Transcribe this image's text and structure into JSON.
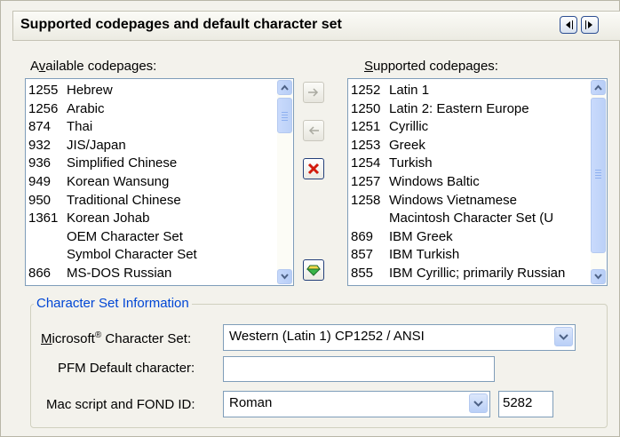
{
  "header": {
    "title": "Supported codepages and  default character set"
  },
  "available": {
    "label_prefix": "A",
    "label_mnemonic": "v",
    "label_suffix": "ailable codepages:",
    "items": [
      {
        "code": "1255",
        "name": "Hebrew"
      },
      {
        "code": "1256",
        "name": "Arabic"
      },
      {
        "code": "874",
        "name": "Thai"
      },
      {
        "code": "932",
        "name": "JIS/Japan"
      },
      {
        "code": "936",
        "name": "Simplified Chinese"
      },
      {
        "code": "949",
        "name": "Korean Wansung"
      },
      {
        "code": "950",
        "name": "Traditional Chinese"
      },
      {
        "code": "1361",
        "name": "Korean Johab"
      },
      {
        "code": "",
        "name": "OEM Character Set"
      },
      {
        "code": "",
        "name": "Symbol Character Set"
      },
      {
        "code": "866",
        "name": "MS-DOS Russian"
      }
    ]
  },
  "supported": {
    "label_mnemonic": "S",
    "label_suffix": "upported codepages:",
    "items": [
      {
        "code": "1252",
        "name": "Latin 1"
      },
      {
        "code": "1250",
        "name": "Latin 2: Eastern Europe"
      },
      {
        "code": "1251",
        "name": "Cyrillic"
      },
      {
        "code": "1253",
        "name": "Greek"
      },
      {
        "code": "1254",
        "name": "Turkish"
      },
      {
        "code": "1257",
        "name": "Windows Baltic"
      },
      {
        "code": "1258",
        "name": "Windows Vietnamese"
      },
      {
        "code": "",
        "name": "Macintosh Character Set (U"
      },
      {
        "code": "869",
        "name": "IBM Greek"
      },
      {
        "code": "857",
        "name": "IBM Turkish"
      },
      {
        "code": "855",
        "name": "IBM Cyrillic; primarily Russian"
      }
    ]
  },
  "icons": {
    "add": "right-arrow-icon",
    "remove": "left-arrow-icon",
    "delete": "red-x-icon",
    "default": "gem-icon",
    "prev": "left-triangle-icon",
    "next": "right-triangle-icon"
  },
  "charinfo": {
    "group_title": "Character Set Information",
    "ms_label_mnemonic": "M",
    "ms_label_suffix": "icrosoft",
    "ms_label_reg": "®",
    "ms_label_tail": " Character Set:",
    "ms_value": "Western (Latin 1) CP1252 / ANSI",
    "pfm_label": "PFM Default character:",
    "pfm_value": "",
    "mac_label": "Mac script and FOND ID:",
    "mac_value": "Roman",
    "fond_id": "5282"
  },
  "colors": {
    "group_title": "#0046d5",
    "delete_red": "#d21a0c",
    "arrow_gray": "#a9a9a0",
    "nav_border": "#2d4f93"
  }
}
